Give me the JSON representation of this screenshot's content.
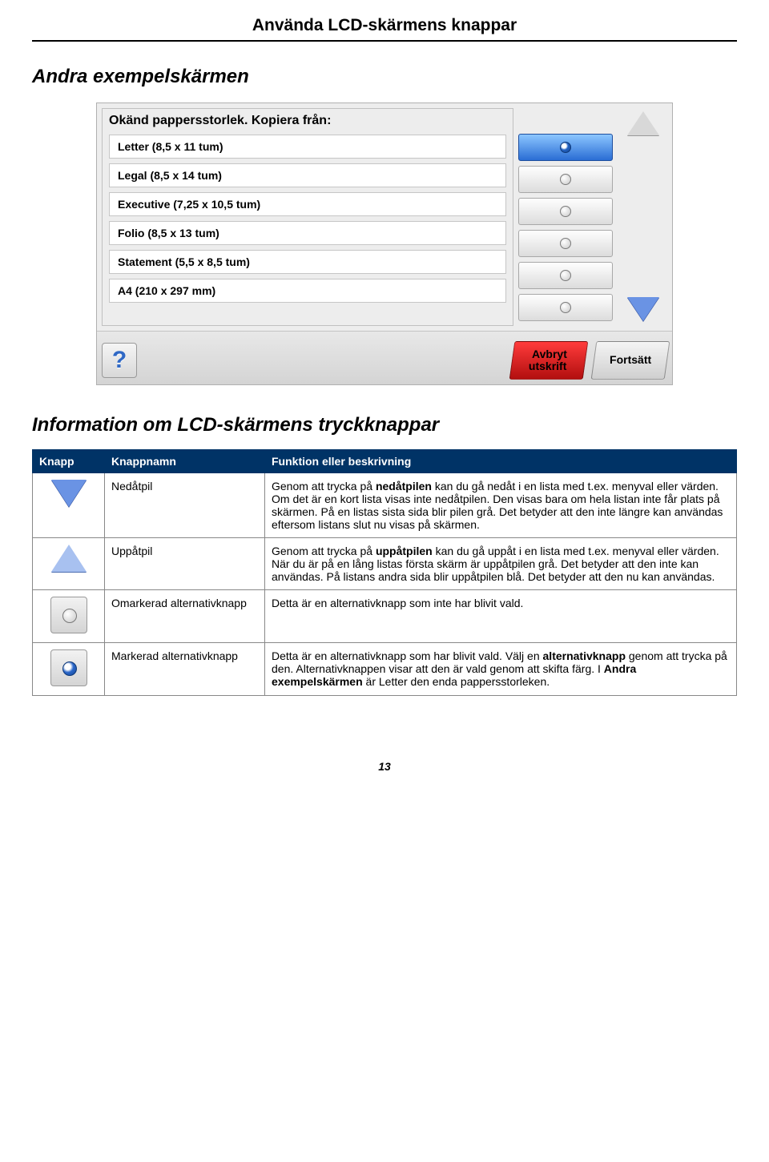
{
  "header": {
    "title": "Använda LCD-skärmens knappar"
  },
  "section1": {
    "title": "Andra exempelskärmen"
  },
  "lcd": {
    "headline": "Okänd pappersstorlek. Kopiera från:",
    "options": [
      "Letter (8,5 x 11 tum)",
      "Legal (8,5 x 14 tum)",
      "Executive (7,25 x 10,5 tum)",
      "Folio (8,5 x 13 tum)",
      "Statement (5,5 x 8,5 tum)",
      "A4 (210 x 297 mm)"
    ],
    "help": "?",
    "cancel_line1": "Avbryt",
    "cancel_line2": "utskrift",
    "continue": "Fortsätt"
  },
  "section2": {
    "title": "Information om LCD-skärmens tryckknappar"
  },
  "table": {
    "headers": {
      "c1": "Knapp",
      "c2": "Knappnamn",
      "c3": "Funktion eller beskrivning"
    },
    "rows": [
      {
        "name": "Nedåtpil",
        "desc_html": "Genom att trycka på <b>nedåtpilen</b> kan du gå nedåt i en lista med t.ex. menyval eller värden. Om det är en kort lista visas inte nedåtpilen. Den visas bara om hela listan inte får plats på skärmen. På en listas sista sida blir pilen grå. Det betyder att den inte längre kan användas eftersom listans slut nu visas på skärmen."
      },
      {
        "name": "Uppåtpil",
        "desc_html": "Genom att trycka på <b>uppåtpilen</b> kan du gå uppåt i en lista med t.ex. menyval eller värden. När du är på en lång listas första skärm är uppåtpilen grå. Det betyder att den inte kan användas. På listans andra sida blir uppåtpilen blå. Det betyder att den nu kan användas."
      },
      {
        "name": "Omarkerad alternativknapp",
        "desc_html": "Detta är en alternativknapp som inte har blivit vald."
      },
      {
        "name": "Markerad alternativknapp",
        "desc_html": "Detta är en alternativknapp som har blivit vald. Välj en <b>alternativknapp</b> genom att trycka på den. Alternativknappen visar att den är vald genom att skifta färg. I <b>Andra exempelskärmen</b> är Letter den enda pappersstorleken."
      }
    ]
  },
  "page_number": "13"
}
